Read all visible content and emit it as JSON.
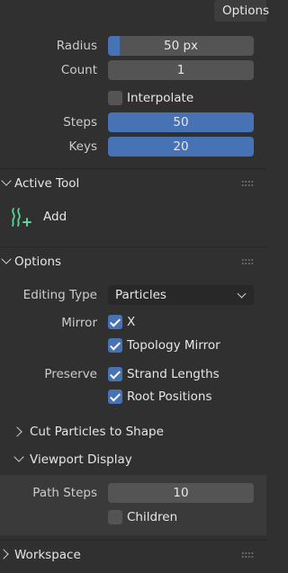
{
  "header": {
    "tab_label": "Options"
  },
  "brush": {
    "radius": {
      "label": "Radius",
      "value": "50 px",
      "fill_fraction": 0.08
    },
    "count": {
      "label": "Count",
      "value": "1"
    },
    "interpolate": {
      "label": "Interpolate",
      "checked": false
    },
    "steps": {
      "label": "Steps",
      "value": "50"
    },
    "keys": {
      "label": "Keys",
      "value": "20"
    }
  },
  "active_tool": {
    "title": "Active Tool",
    "tool_label": "Add",
    "tool_icon": "hair-add-icon",
    "accent_color": "#59d59a"
  },
  "options": {
    "title": "Options",
    "editing_type": {
      "label": "Editing Type",
      "value": "Particles"
    },
    "mirror": {
      "label": "Mirror",
      "x_label": "X",
      "topology_label": "Topology Mirror"
    },
    "preserve": {
      "label": "Preserve",
      "strand_label": "Strand Lengths",
      "root_label": "Root Positions"
    },
    "cut_particles": {
      "title": "Cut Particles to Shape"
    },
    "viewport_display": {
      "title": "Viewport Display",
      "path_steps": {
        "label": "Path Steps",
        "value": "10"
      },
      "children_label": "Children"
    }
  },
  "workspace": {
    "title": "Workspace"
  },
  "colors": {
    "accent_blue": "#4772b3",
    "background": "#303030",
    "field": "#545454"
  }
}
